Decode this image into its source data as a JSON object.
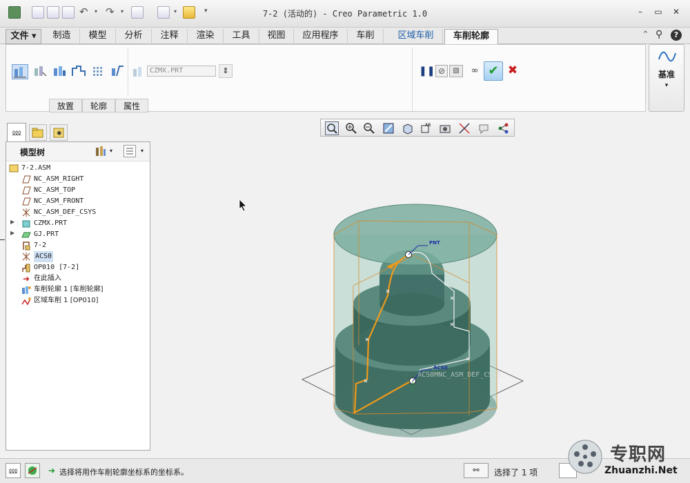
{
  "window": {
    "title": "7-2 (活动的) - Creo Parametric 1.0"
  },
  "menu_tabs": [
    {
      "label": "文件 ▾"
    },
    {
      "label": "制造"
    },
    {
      "label": "模型"
    },
    {
      "label": "分析"
    },
    {
      "label": "注释"
    },
    {
      "label": "渲染"
    },
    {
      "label": "工具"
    },
    {
      "label": "视图"
    },
    {
      "label": "应用程序"
    },
    {
      "label": "车削"
    },
    {
      "label": "区域车削"
    },
    {
      "label": "车削轮廓"
    }
  ],
  "ribbon": {
    "model_field_value": "CZMX.PRT",
    "subtabs": [
      "放置",
      "轮廓",
      "属性"
    ],
    "datum_label": "基准"
  },
  "nav_panel": {
    "title": "模型树"
  },
  "tree": [
    {
      "label": "7-2.ASM",
      "icon": "assembly-icon"
    },
    {
      "label": "NC_ASM_RIGHT",
      "icon": "datum-plane-icon"
    },
    {
      "label": "NC_ASM_TOP",
      "icon": "datum-plane-icon"
    },
    {
      "label": "NC_ASM_FRONT",
      "icon": "datum-plane-icon"
    },
    {
      "label": "NC_ASM_DEF_CSYS",
      "icon": "csys-icon"
    },
    {
      "label": "CZMX.PRT",
      "icon": "part-icon"
    },
    {
      "label": "GJ.PRT",
      "icon": "workpiece-icon"
    },
    {
      "label": "7-2",
      "icon": "mfg-icon"
    },
    {
      "label": "ACS0",
      "icon": "csys-icon"
    },
    {
      "label": "OP010 [7-2]",
      "icon": "operation-icon"
    },
    {
      "label": "在此插入",
      "icon": "insert-arrow-icon"
    },
    {
      "label": "车削轮廓 1 [车削轮廓]",
      "icon": "turn-profile-icon"
    },
    {
      "label": "区域车削 1 [OP010]",
      "icon": "area-turn-icon"
    }
  ],
  "viewport": {
    "csys_label_top": "PNT",
    "csys_label_bottom": "ACS0",
    "csys_label_overlay": "ACS0MNC_ASM_DEF_CSYS"
  },
  "status": {
    "message": "选择将用作车削轮廓坐标系的坐标系。",
    "selection": "选择了 1 项"
  },
  "watermark": {
    "text_cn": "专职网",
    "text_url": "Zhuanzhi.Net"
  }
}
